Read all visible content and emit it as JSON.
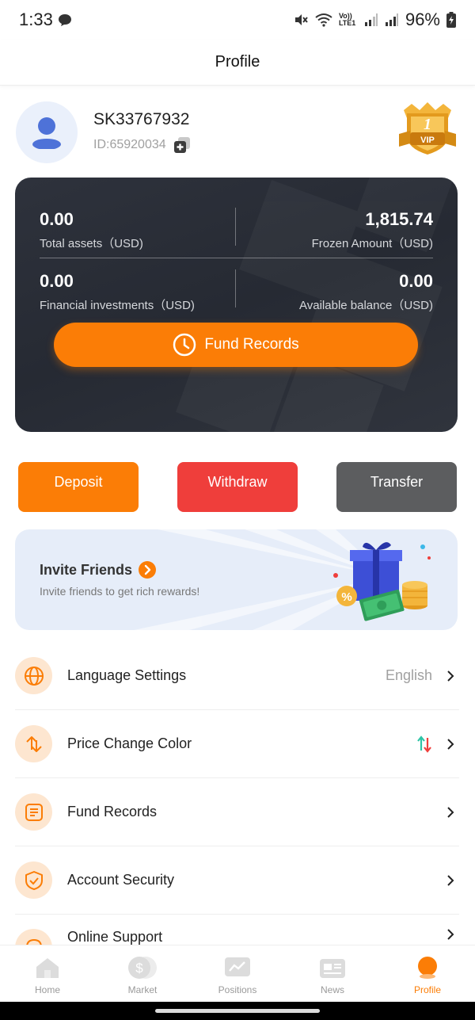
{
  "status_bar": {
    "time": "1:33",
    "network_label": "Vo)) LTE1",
    "battery": "96%"
  },
  "header": {
    "title": "Profile"
  },
  "profile": {
    "username": "SK33767932",
    "user_id": "ID:65920034",
    "vip_level": "1",
    "vip_label": "VIP"
  },
  "assets": {
    "total_assets": {
      "value": "0.00",
      "label": "Total assets（USD)"
    },
    "frozen_amount": {
      "value": "1,815.74",
      "label": "Frozen Amount（USD)"
    },
    "financial_investments": {
      "value": "0.00",
      "label": "Financial investments（USD)"
    },
    "available_balance": {
      "value": "0.00",
      "label": "Available balance（USD)"
    },
    "fund_records_button": "Fund Records"
  },
  "actions": {
    "deposit": "Deposit",
    "withdraw": "Withdraw",
    "transfer": "Transfer"
  },
  "invite": {
    "title": "Invite Friends",
    "subtitle": "Invite friends to get rich rewards!"
  },
  "menu": [
    {
      "label": "Language Settings",
      "value": "English",
      "icon": "globe-icon"
    },
    {
      "label": "Price Change Color",
      "value": "",
      "icon": "exchange-arrows-icon"
    },
    {
      "label": "Fund Records",
      "value": "",
      "icon": "document-icon"
    },
    {
      "label": "Account Security",
      "value": "",
      "icon": "shield-check-icon"
    },
    {
      "label": "Online Support",
      "value": "",
      "icon": "headset-icon"
    }
  ],
  "tabs": [
    {
      "label": "Home",
      "icon": "home-icon"
    },
    {
      "label": "Market",
      "icon": "dollar-coin-icon"
    },
    {
      "label": "Positions",
      "icon": "chart-icon"
    },
    {
      "label": "News",
      "icon": "newspaper-icon"
    },
    {
      "label": "Profile",
      "icon": "profile-icon",
      "active": true
    }
  ],
  "colors": {
    "accent": "#fb7d06",
    "withdraw": "#ef3e3b",
    "transfer": "#5c5d5f",
    "card_dark": "#2a2e37",
    "rise": "#2ec4a6",
    "fall": "#ef3e3b"
  }
}
